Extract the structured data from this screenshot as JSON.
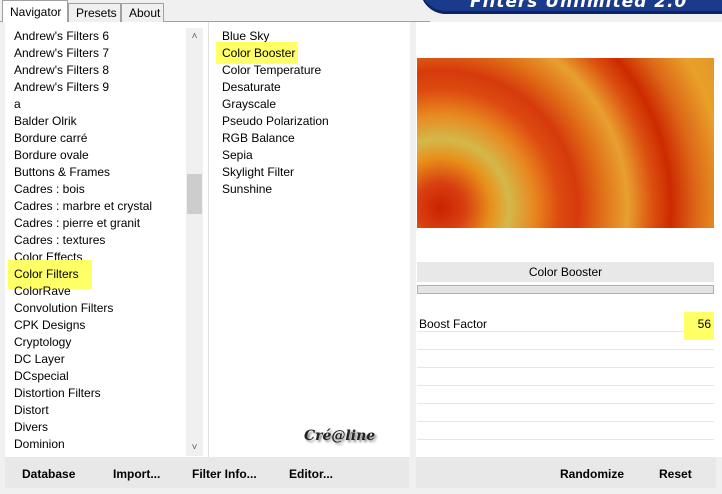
{
  "tabs": [
    {
      "label": "Navigator",
      "active": true
    },
    {
      "label": "Presets",
      "active": false
    },
    {
      "label": "About",
      "active": false
    }
  ],
  "banner": {
    "title": "Filters Unlimited 2.0",
    "color": "#1a3a8c"
  },
  "categories": [
    "Andrew's Filters 6",
    "Andrew's Filters 7",
    "Andrew's Filters 8",
    "Andrew's Filters 9",
    "a",
    "Balder Olrik",
    "Bordure carré",
    "Bordure ovale",
    "Buttons & Frames",
    "Cadres : bois",
    "Cadres : marbre et crystal",
    "Cadres : pierre et granit",
    "Cadres : textures",
    "Color Effects",
    "Color Filters",
    "ColorRave",
    "Convolution Filters",
    "CPK Designs",
    "Cryptology",
    "DC Layer",
    "DCspecial",
    "Distortion Filters",
    "Distort",
    "Divers",
    "Dominion"
  ],
  "selected_category": "Color Filters",
  "filters": [
    "Blue Sky",
    "Color Booster",
    "Color Temperature",
    "Desaturate",
    "Grayscale",
    "Pseudo Polarization",
    "RGB Balance",
    "Sepia",
    "Skylight Filter",
    "Sunshine"
  ],
  "selected_filter": "Color Booster",
  "filter_title": "Color Booster",
  "params": [
    {
      "label": "Boost Factor",
      "value": "56"
    }
  ],
  "watermark": "Cré@line",
  "buttons": {
    "database": "Database",
    "import": "Import...",
    "filter_info": "Filter Info...",
    "editor": "Editor...",
    "randomize": "Randomize",
    "reset": "Reset"
  },
  "colors": {
    "highlight": "#ffff66"
  }
}
